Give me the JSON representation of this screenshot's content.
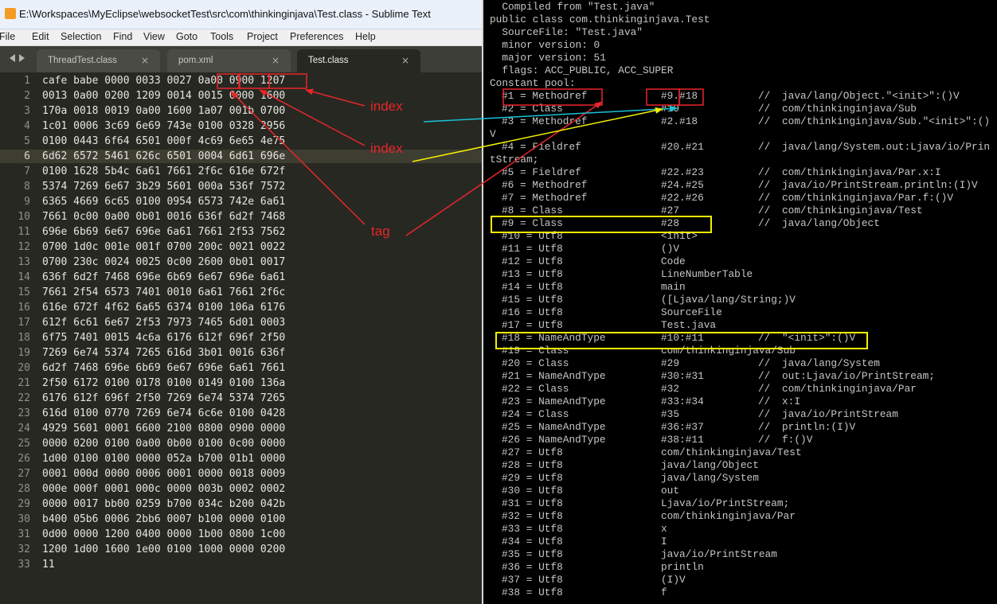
{
  "window": {
    "title": "E:\\Workspaces\\MyEclipse\\websocketTest\\src\\com\\thinkinginjava\\Test.class - Sublime Text"
  },
  "menu": [
    "File",
    "Edit",
    "Selection",
    "Find",
    "View",
    "Goto",
    "Tools",
    "Project",
    "Preferences",
    "Help"
  ],
  "tabs": [
    {
      "label": "ThreadTest.class",
      "close": "×"
    },
    {
      "label": "pom.xml",
      "close": "×"
    },
    {
      "label": "Test.class",
      "close": "×"
    }
  ],
  "editor": {
    "lines": [
      "cafe babe 0000 0033 0027 0a00 0900 1207",
      "0013 0a00 0200 1209 0014 0015 0000 1600",
      "170a 0018 0019 0a00 1600 1a07 001b 0700",
      "1c01 0006 3c69 6e69 743e 0100 0328 2956",
      "0100 0443 6f64 6501 000f 4c69 6e65 4e75",
      "6d62 6572 5461 626c 6501 0004 6d61 696e",
      "0100 1628 5b4c 6a61 7661 2f6c 616e 672f",
      "5374 7269 6e67 3b29 5601 000a 536f 7572",
      "6365 4669 6c65 0100 0954 6573 742e 6a61",
      "7661 0c00 0a00 0b01 0016 636f 6d2f 7468",
      "696e 6b69 6e67 696e 6a61 7661 2f53 7562",
      "0700 1d0c 001e 001f 0700 200c 0021 0022",
      "0700 230c 0024 0025 0c00 2600 0b01 0017",
      "636f 6d2f 7468 696e 6b69 6e67 696e 6a61",
      "7661 2f54 6573 7401 0010 6a61 7661 2f6c",
      "616e 672f 4f62 6a65 6374 0100 106a 6176",
      "612f 6c61 6e67 2f53 7973 7465 6d01 0003",
      "6f75 7401 0015 4c6a 6176 612f 696f 2f50",
      "7269 6e74 5374 7265 616d 3b01 0016 636f",
      "6d2f 7468 696e 6b69 6e67 696e 6a61 7661",
      "2f50 6172 0100 0178 0100 0149 0100 136a",
      "6176 612f 696f 2f50 7269 6e74 5374 7265",
      "616d 0100 0770 7269 6e74 6c6e 0100 0428",
      "4929 5601 0001 6600 2100 0800 0900 0000",
      "0000 0200 0100 0a00 0b00 0100 0c00 0000",
      "1d00 0100 0100 0000 052a b700 01b1 0000",
      "0001 000d 0000 0006 0001 0000 0018 0009",
      "000e 000f 0001 000c 0000 003b 0002 0002",
      "0000 0017 bb00 0259 b700 034c b200 042b",
      "b400 05b6 0006 2bb6 0007 b100 0000 0100",
      "0d00 0000 1200 0400 0000 1b00 0800 1c00",
      "1200 1d00 1600 1e00 0100 1000 0000 0200",
      "11"
    ]
  },
  "console": {
    "header": [
      "  Compiled from \"Test.java\"",
      "public class com.thinkinginjava.Test",
      "  SourceFile: \"Test.java\"",
      "  minor version: 0",
      "  major version: 51",
      "  flags: ACC_PUBLIC, ACC_SUPER",
      "Constant pool:"
    ],
    "entries": [
      {
        "id": "#1 = Methodref",
        "ref": "#9.#18",
        "comment": "//",
        "desc": "java/lang/Object.\"<init>\":()V"
      },
      {
        "id": "#2 = Class",
        "ref": "#19",
        "comment": "//",
        "desc": "com/thinkinginjava/Sub"
      },
      {
        "id": "#3 = Methodref",
        "ref": "#2.#18",
        "comment": "//",
        "desc": "com/thinkinginjava/Sub.\"<init>\":()"
      },
      {
        "wrap": "V"
      },
      {
        "id": "#4 = Fieldref",
        "ref": "#20.#21",
        "comment": "//",
        "desc": "java/lang/System.out:Ljava/io/Prin"
      },
      {
        "wrap": "tStream;"
      },
      {
        "id": "#5 = Fieldref",
        "ref": "#22.#23",
        "comment": "//",
        "desc": "com/thinkinginjava/Par.x:I"
      },
      {
        "id": "#6 = Methodref",
        "ref": "#24.#25",
        "comment": "//",
        "desc": "java/io/PrintStream.println:(I)V"
      },
      {
        "id": "#7 = Methodref",
        "ref": "#22.#26",
        "comment": "//",
        "desc": "com/thinkinginjava/Par.f:()V"
      },
      {
        "id": "#8 = Class",
        "ref": "#27",
        "comment": "//",
        "desc": "com/thinkinginjava/Test"
      },
      {
        "id": "#9 = Class",
        "ref": "#28",
        "comment": "//",
        "desc": "java/lang/Object"
      },
      {
        "id": "#10 = Utf8",
        "ref": "<init>"
      },
      {
        "id": "#11 = Utf8",
        "ref": "()V"
      },
      {
        "id": "#12 = Utf8",
        "ref": "Code"
      },
      {
        "id": "#13 = Utf8",
        "ref": "LineNumberTable"
      },
      {
        "id": "#14 = Utf8",
        "ref": "main"
      },
      {
        "id": "#15 = Utf8",
        "ref": "([Ljava/lang/String;)V"
      },
      {
        "id": "#16 = Utf8",
        "ref": "SourceFile"
      },
      {
        "id": "#17 = Utf8",
        "ref": "Test.java"
      },
      {
        "id": "#18 = NameAndType",
        "ref": "#10:#11",
        "comment": "//",
        "desc": "\"<init>\":()V"
      },
      {
        "id": "#19 = Class",
        "ref": "com/thinkinginjava/Sub"
      },
      {
        "id": "#20 = Class",
        "ref": "#29",
        "comment": "//",
        "desc": "java/lang/System"
      },
      {
        "id": "#21 = NameAndType",
        "ref": "#30:#31",
        "comment": "//",
        "desc": "out:Ljava/io/PrintStream;"
      },
      {
        "id": "#22 = Class",
        "ref": "#32",
        "comment": "//",
        "desc": "com/thinkinginjava/Par"
      },
      {
        "id": "#23 = NameAndType",
        "ref": "#33:#34",
        "comment": "//",
        "desc": "x:I"
      },
      {
        "id": "#24 = Class",
        "ref": "#35",
        "comment": "//",
        "desc": "java/io/PrintStream"
      },
      {
        "id": "#25 = NameAndType",
        "ref": "#36:#37",
        "comment": "//",
        "desc": "println:(I)V"
      },
      {
        "id": "#26 = NameAndType",
        "ref": "#38:#11",
        "comment": "//",
        "desc": "f:()V"
      },
      {
        "id": "#27 = Utf8",
        "ref": "com/thinkinginjava/Test"
      },
      {
        "id": "#28 = Utf8",
        "ref": "java/lang/Object"
      },
      {
        "id": "#29 = Utf8",
        "ref": "java/lang/System"
      },
      {
        "id": "#30 = Utf8",
        "ref": "out"
      },
      {
        "id": "#31 = Utf8",
        "ref": "Ljava/io/PrintStream;"
      },
      {
        "id": "#32 = Utf8",
        "ref": "com/thinkinginjava/Par"
      },
      {
        "id": "#33 = Utf8",
        "ref": "x"
      },
      {
        "id": "#34 = Utf8",
        "ref": "I"
      },
      {
        "id": "#35 = Utf8",
        "ref": "java/io/PrintStream"
      },
      {
        "id": "#36 = Utf8",
        "ref": "println"
      },
      {
        "id": "#37 = Utf8",
        "ref": "(I)V"
      },
      {
        "id": "#38 = Utf8",
        "ref": "f"
      }
    ]
  },
  "annotations": {
    "labels": [
      "index",
      "index",
      "tag"
    ],
    "colors": {
      "red": "#e8262a",
      "yellow": "#f5f000",
      "cyan": "#19c2d8"
    }
  }
}
